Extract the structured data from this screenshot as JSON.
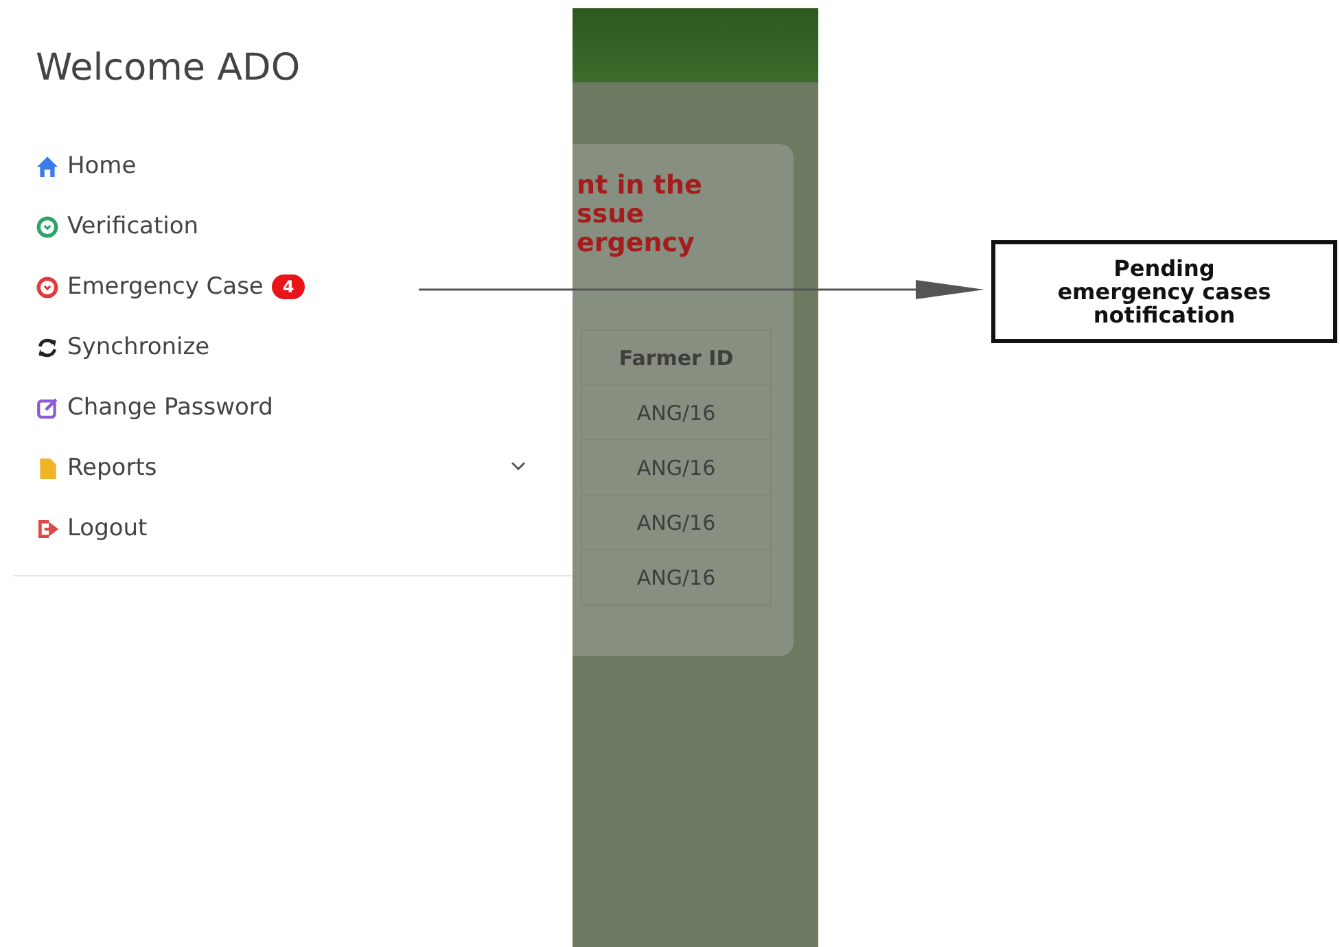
{
  "drawer": {
    "title": "Welcome ADO",
    "items": [
      {
        "label": "Home"
      },
      {
        "label": "Verification"
      },
      {
        "label": "Emergency Case",
        "badge": "4"
      },
      {
        "label": "Synchronize"
      },
      {
        "label": "Change Password"
      },
      {
        "label": "Reports",
        "expandable": true
      },
      {
        "label": "Logout"
      }
    ]
  },
  "background_screen": {
    "card_heading": [
      "nt in the",
      "ssue",
      "ergency"
    ],
    "table": {
      "columns": [
        "Farmer ID"
      ],
      "rows": [
        [
          "ANG/16"
        ],
        [
          "ANG/16"
        ],
        [
          "ANG/16"
        ],
        [
          "ANG/16"
        ]
      ]
    }
  },
  "annotation": {
    "text": "Pending emergency cases notification"
  }
}
